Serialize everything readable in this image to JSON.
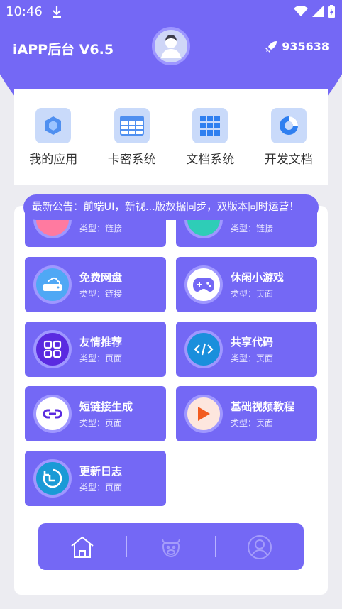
{
  "status_bar": {
    "time": "10:46"
  },
  "header": {
    "title": "iAPP后台 V6.5",
    "points": "935638"
  },
  "nav": [
    {
      "label": "我的应用",
      "icon": "hexagon-icon"
    },
    {
      "label": "卡密系统",
      "icon": "table-icon"
    },
    {
      "label": "文档系统",
      "icon": "grid-icon"
    },
    {
      "label": "开发文档",
      "icon": "pie-chart-icon"
    }
  ],
  "notice": {
    "text": "最新公告：前端UI，新视...版数据同步，双版本同时运营！"
  },
  "tiles_partial": [
    {
      "type": "类型：链接"
    },
    {
      "type": "类型：链接"
    }
  ],
  "tiles": [
    {
      "title": "免费网盘",
      "type": "类型：链接",
      "icon": "cloud-drive-icon"
    },
    {
      "title": "休闲小游戏",
      "type": "类型：页面",
      "icon": "gamepad-icon"
    },
    {
      "title": "友情推荐",
      "type": "类型：页面",
      "icon": "apps-icon"
    },
    {
      "title": "共享代码",
      "type": "类型：页面",
      "icon": "code-icon"
    },
    {
      "title": "短链接生成",
      "type": "类型：页面",
      "icon": "link-icon"
    },
    {
      "title": "基础视频教程",
      "type": "类型：页面",
      "icon": "play-icon"
    },
    {
      "title": "更新日志",
      "type": "类型：页面",
      "icon": "clock-icon"
    }
  ],
  "colors": {
    "primary": "#7468f5",
    "tile_border": "#9f97ff",
    "nav_icon_bg": "#c9dafa"
  }
}
